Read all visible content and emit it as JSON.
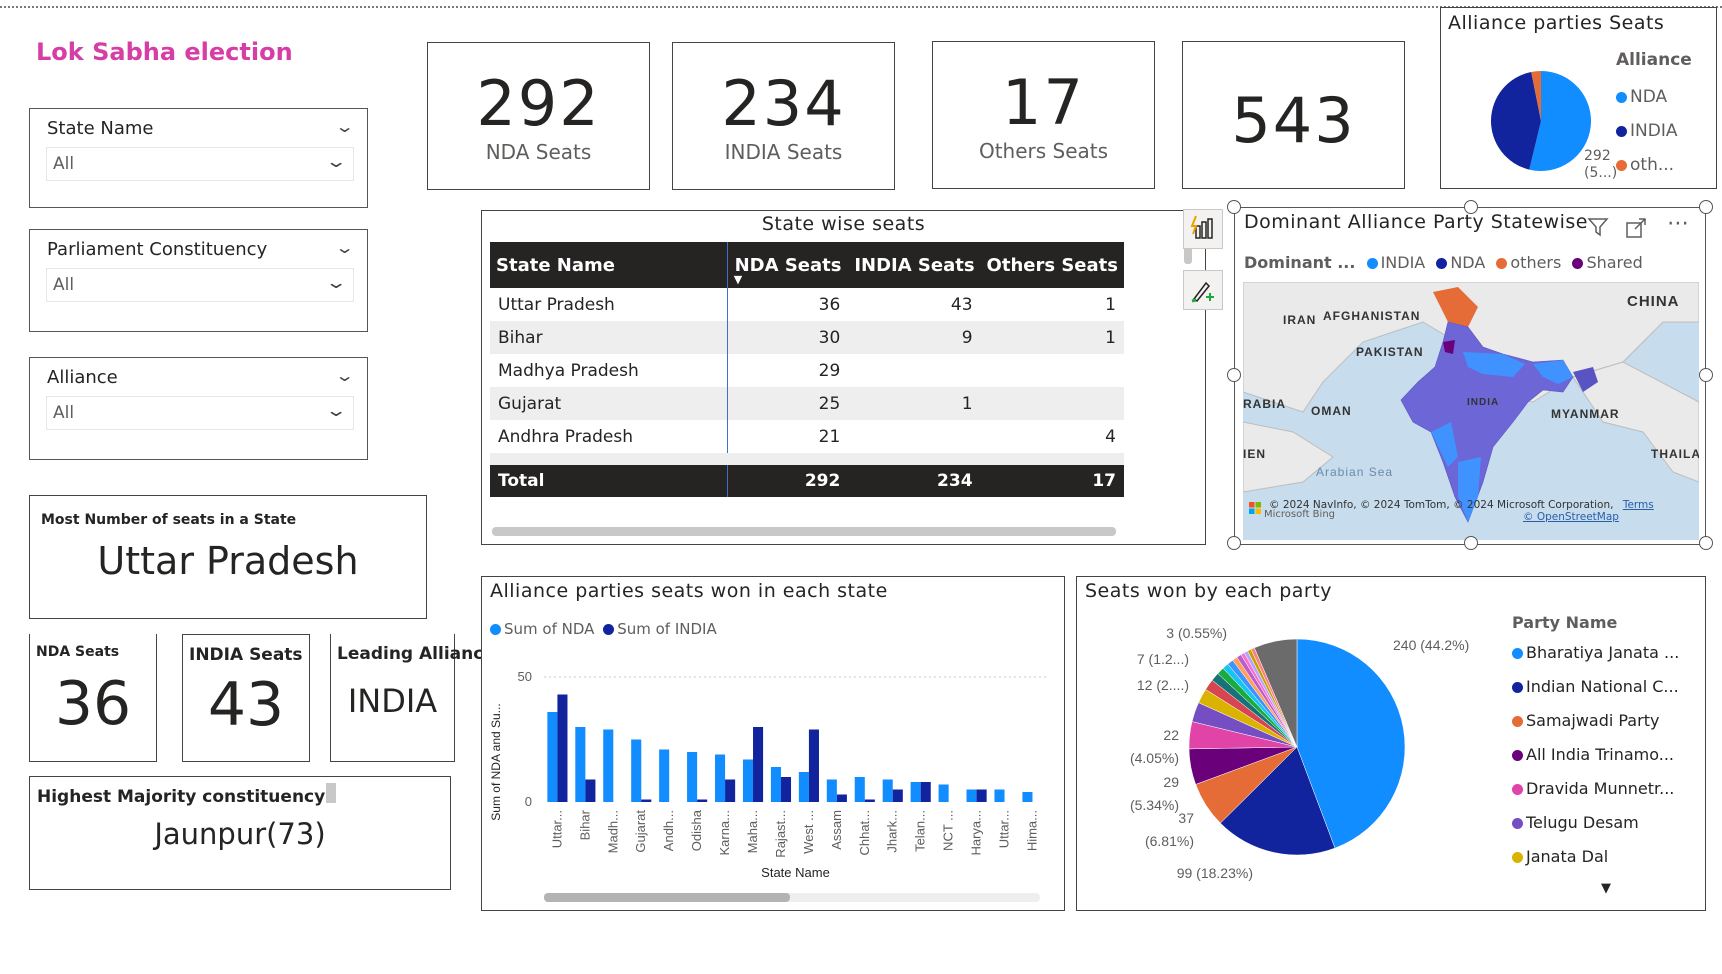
{
  "page_title": "Lok Sabha election",
  "slicers": [
    {
      "label": "State Name",
      "value": "All"
    },
    {
      "label": "Parliament Constituency",
      "value": "All"
    },
    {
      "label": "Alliance",
      "value": "All"
    }
  ],
  "kpi_cards": [
    {
      "value": "292",
      "label": "NDA Seats"
    },
    {
      "value": "234",
      "label": "INDIA Seats"
    },
    {
      "value": "17",
      "label": "Others Seats"
    },
    {
      "value": "543",
      "label": ""
    }
  ],
  "alliance_pie": {
    "title": "Alliance parties Seats",
    "legend_title": "Alliance",
    "legend": [
      "NDA",
      "INDIA",
      "oth..."
    ],
    "data_label": "292",
    "data_label_2": "(5...)",
    "colors": {
      "NDA": "#118dff",
      "INDIA": "#12239e",
      "others": "#e66c37"
    },
    "values": {
      "NDA": 292,
      "INDIA": 234,
      "others": 17
    }
  },
  "state_table": {
    "title": "State wise seats",
    "headers": [
      "State Name",
      "NDA Seats",
      "INDIA Seats",
      "Others Seats"
    ],
    "rows": [
      [
        "Uttar Pradesh",
        "36",
        "43",
        "1"
      ],
      [
        "Bihar",
        "30",
        "9",
        "1"
      ],
      [
        "Madhya Pradesh",
        "29",
        "",
        ""
      ],
      [
        "Gujarat",
        "25",
        "1",
        ""
      ],
      [
        "Andhra Pradesh",
        "21",
        "",
        "4"
      ]
    ],
    "total": [
      "Total",
      "292",
      "234",
      "17"
    ]
  },
  "map": {
    "title": "Dominant Alliance Party Statewise",
    "legend_title": "Dominant ...",
    "legend": [
      "INDIA",
      "NDA",
      "others",
      "Shared"
    ],
    "legend_colors": [
      "#118dff",
      "#12239e",
      "#e66c37",
      "#6b007b"
    ],
    "labels": [
      "CHINA",
      "IRAN",
      "AFGHANISTAN",
      "PAKISTAN",
      "INDIA",
      "RABIA",
      "OMAN",
      "MYANMAR",
      "THAILANI",
      "IEN",
      "Arabian Sea"
    ],
    "attribution": "© 2024 NavInfo, © 2024 TomTom, © 2024 Microsoft Corporation,",
    "attribution_terms": "Terms",
    "attribution_osm": "© OpenStreetMap",
    "attribution_bing": "Microsoft Bing"
  },
  "most_seats": {
    "label": "Most Number of seats in a State",
    "value": "Uttar Pradesh"
  },
  "mini_cards": [
    {
      "label": "NDA Seats",
      "value": "36"
    },
    {
      "label": "INDIA Seats",
      "value": "43"
    },
    {
      "label": "Leading Alliance",
      "value": "INDIA"
    }
  ],
  "highest_majority": {
    "label": "Highest Majority constituency",
    "value": "Jaunpur(73)"
  },
  "chart_data": [
    {
      "type": "bar",
      "title": "Alliance parties seats won in each state",
      "xlabel": "State Name",
      "ylabel": "Sum of NDA and Su...",
      "ylim": [
        0,
        60
      ],
      "yticks": [
        "0",
        "50"
      ],
      "categories": [
        "Uttar...",
        "Bihar",
        "Madh...",
        "Gujarat",
        "Andh...",
        "Odisha",
        "Karna...",
        "Maha...",
        "Rajast...",
        "West ...",
        "Assam",
        "Chhat...",
        "Jhark...",
        "Telan...",
        "NCT ...",
        "Harya...",
        "Uttar...",
        "Hima..."
      ],
      "series": [
        {
          "name": "Sum of NDA",
          "color": "#118dff",
          "values": [
            36,
            30,
            29,
            25,
            21,
            20,
            19,
            17,
            14,
            12,
            9,
            10,
            9,
            8,
            7,
            5,
            5,
            4
          ]
        },
        {
          "name": "Sum of INDIA",
          "color": "#12239e",
          "values": [
            43,
            9,
            0,
            1,
            0,
            1,
            9,
            30,
            10,
            29,
            3,
            1,
            5,
            8,
            0,
            5,
            0,
            0
          ]
        }
      ]
    },
    {
      "type": "pie",
      "title": "Seats won by each party",
      "legend_title": "Party Name",
      "legend": [
        "Bharatiya Janata ...",
        "Indian National C...",
        "Samajwadi Party",
        "All India Trinamo...",
        "Dravida Munnetr...",
        "Telugu Desam",
        "Janata Dal"
      ],
      "slices": [
        {
          "value": 240,
          "color": "#118dff"
        },
        {
          "value": 99,
          "color": "#12239e"
        },
        {
          "value": 37,
          "color": "#e66c37"
        },
        {
          "value": 29,
          "color": "#6b007b"
        },
        {
          "value": 22,
          "color": "#e044a7"
        },
        {
          "value": 16,
          "color": "#744ec2"
        },
        {
          "value": 12,
          "color": "#d9b300"
        },
        {
          "value": 9,
          "color": "#d64550"
        },
        {
          "value": 7,
          "color": "#197278"
        },
        {
          "value": 6,
          "color": "#1aab40"
        },
        {
          "value": 5,
          "color": "#15c6f4"
        },
        {
          "value": 5,
          "color": "#4092ff"
        },
        {
          "value": 4,
          "color": "#ffa058"
        },
        {
          "value": 4,
          "color": "#be5dc9"
        },
        {
          "value": 3,
          "color": "#f472d0"
        },
        {
          "value": 3,
          "color": "#b5a1ff"
        },
        {
          "value": 3,
          "color": "#c4a200"
        },
        {
          "value": 3,
          "color": "#ff8080"
        },
        {
          "value": 35,
          "color": "#6b6b6b"
        }
      ],
      "data_labels": [
        "240 (44.2%)",
        "99 (18.23%)",
        "37",
        "(6.81%)",
        "29",
        "(5.34%)",
        "22",
        "(4.05%)",
        "12 (2....)",
        "7 (1.2...)",
        "3 (0.55%)"
      ]
    }
  ]
}
